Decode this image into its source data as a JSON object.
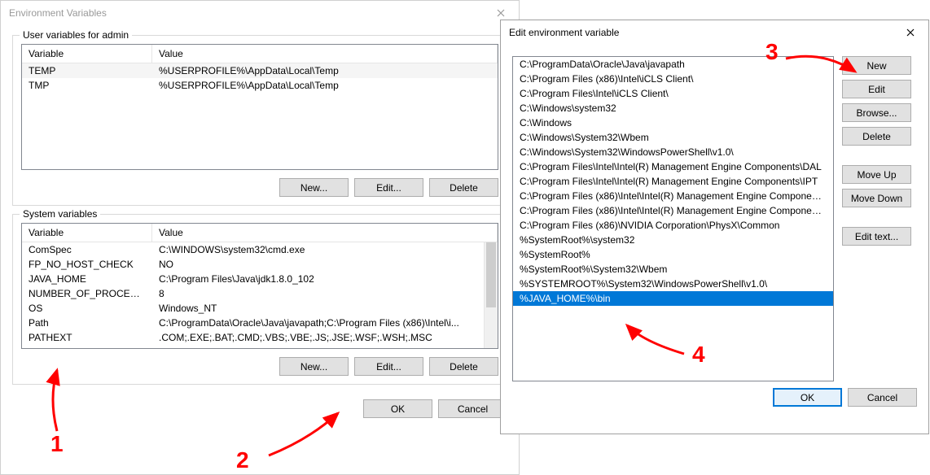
{
  "envDialog": {
    "title": "Environment Variables",
    "userGroupLabel": "User variables for admin",
    "sysGroupLabel": "System variables",
    "columns": {
      "variable": "Variable",
      "value": "Value"
    },
    "userVars": [
      {
        "name": "TEMP",
        "value": "%USERPROFILE%\\AppData\\Local\\Temp"
      },
      {
        "name": "TMP",
        "value": "%USERPROFILE%\\AppData\\Local\\Temp"
      }
    ],
    "sysVars": [
      {
        "name": "ComSpec",
        "value": "C:\\WINDOWS\\system32\\cmd.exe"
      },
      {
        "name": "FP_NO_HOST_CHECK",
        "value": "NO"
      },
      {
        "name": "JAVA_HOME",
        "value": "C:\\Program Files\\Java\\jdk1.8.0_102"
      },
      {
        "name": "NUMBER_OF_PROCESSORS",
        "value": "8"
      },
      {
        "name": "OS",
        "value": "Windows_NT"
      },
      {
        "name": "Path",
        "value": "C:\\ProgramData\\Oracle\\Java\\javapath;C:\\Program Files (x86)\\Intel\\i..."
      },
      {
        "name": "PATHEXT",
        "value": ".COM;.EXE;.BAT;.CMD;.VBS;.VBE;.JS;.JSE;.WSF;.WSH;.MSC"
      }
    ],
    "buttons": {
      "new": "New...",
      "edit": "Edit...",
      "delete": "Delete",
      "ok": "OK",
      "cancel": "Cancel"
    }
  },
  "editDialog": {
    "title": "Edit environment variable",
    "entries": [
      "C:\\ProgramData\\Oracle\\Java\\javapath",
      "C:\\Program Files (x86)\\Intel\\iCLS Client\\",
      "C:\\Program Files\\Intel\\iCLS Client\\",
      "C:\\Windows\\system32",
      "C:\\Windows",
      "C:\\Windows\\System32\\Wbem",
      "C:\\Windows\\System32\\WindowsPowerShell\\v1.0\\",
      "C:\\Program Files\\Intel\\Intel(R) Management Engine Components\\DAL",
      "C:\\Program Files\\Intel\\Intel(R) Management Engine Components\\IPT",
      "C:\\Program Files (x86)\\Intel\\Intel(R) Management Engine Component...",
      "C:\\Program Files (x86)\\Intel\\Intel(R) Management Engine Component...",
      "C:\\Program Files (x86)\\NVIDIA Corporation\\PhysX\\Common",
      "%SystemRoot%\\system32",
      "%SystemRoot%",
      "%SystemRoot%\\System32\\Wbem",
      "%SYSTEMROOT%\\System32\\WindowsPowerShell\\v1.0\\",
      "%JAVA_HOME%\\bin"
    ],
    "selectedIndex": 16,
    "buttons": {
      "new": "New",
      "edit": "Edit",
      "browse": "Browse...",
      "delete": "Delete",
      "moveUp": "Move Up",
      "moveDown": "Move Down",
      "editText": "Edit text...",
      "ok": "OK",
      "cancel": "Cancel"
    }
  },
  "annotations": {
    "n1": "1",
    "n2": "2",
    "n3": "3",
    "n4": "4"
  }
}
